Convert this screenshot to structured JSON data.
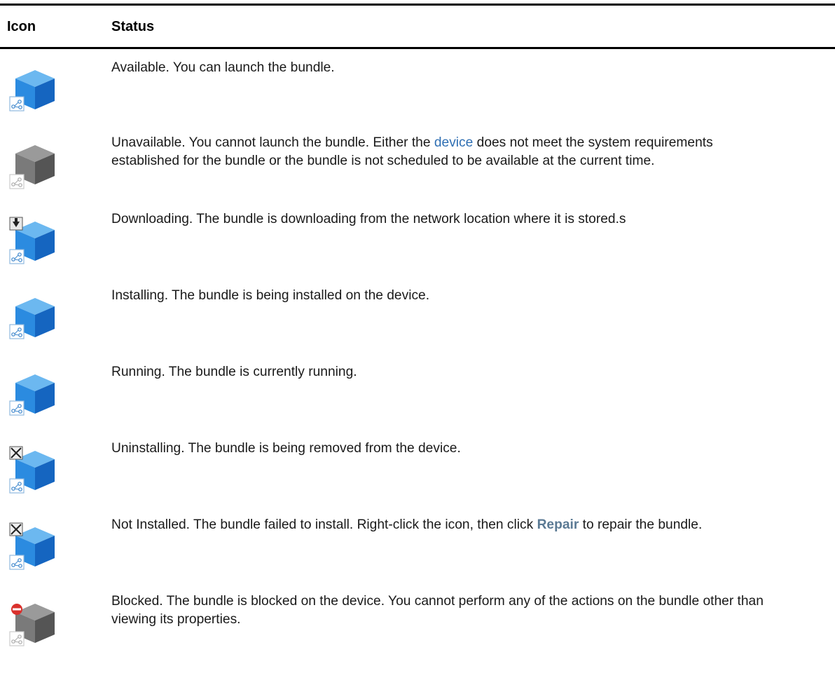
{
  "table": {
    "headers": {
      "icon": "Icon",
      "status": "Status"
    },
    "rows": [
      {
        "icon": "bundle-available-icon",
        "segments": [
          {
            "t": "text",
            "v": "Available. You can launch the bundle."
          }
        ]
      },
      {
        "icon": "bundle-unavailable-icon",
        "segments": [
          {
            "t": "text",
            "v": "Unavailable. You cannot launch the bundle. Either the "
          },
          {
            "t": "link",
            "v": "device"
          },
          {
            "t": "text",
            "v": " does not meet the system requirements established for the bundle or the bundle is not scheduled to be available at the current time."
          }
        ]
      },
      {
        "icon": "bundle-downloading-icon",
        "segments": [
          {
            "t": "text",
            "v": "Downloading. The bundle is downloading from the network location where it is stored.s"
          }
        ]
      },
      {
        "icon": "bundle-installing-icon",
        "segments": [
          {
            "t": "text",
            "v": "Installing. The bundle is being installed on the device."
          }
        ]
      },
      {
        "icon": "bundle-running-icon",
        "segments": [
          {
            "t": "text",
            "v": "Running. The bundle is currently running."
          }
        ]
      },
      {
        "icon": "bundle-uninstalling-icon",
        "segments": [
          {
            "t": "text",
            "v": "Uninstalling. The bundle is being removed from the device."
          }
        ]
      },
      {
        "icon": "bundle-not-installed-icon",
        "segments": [
          {
            "t": "text",
            "v": "Not Installed. The bundle failed to install. Right-click the icon, then click "
          },
          {
            "t": "ui",
            "v": "Repair"
          },
          {
            "t": "text",
            "v": " to repair the bundle."
          }
        ]
      },
      {
        "icon": "bundle-blocked-icon",
        "segments": [
          {
            "t": "text",
            "v": "Blocked. The bundle is blocked on the device. You cannot perform any of the actions on the bundle other than viewing its properties."
          }
        ]
      }
    ]
  },
  "colors": {
    "link": "#2f6fb3",
    "ui_label": "#5b7a94",
    "cube_blue_top": "#6cb8f0",
    "cube_blue_left": "#2b8be0",
    "cube_blue_right": "#1565c0",
    "cube_gray_top": "#9a9a9a",
    "cube_gray_left": "#7a7a7a",
    "cube_gray_right": "#555555"
  }
}
